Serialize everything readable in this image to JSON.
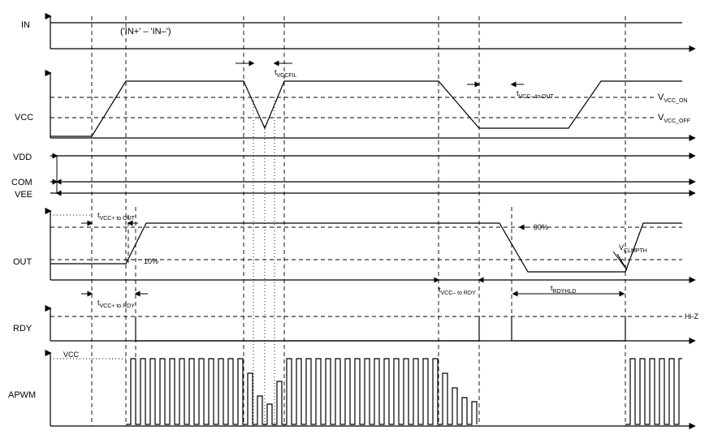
{
  "signal_labels": {
    "in": "IN",
    "vcc": "VCC",
    "vdd": "VDD",
    "com": "COM",
    "vee": "VEE",
    "out": "OUT",
    "rdy": "RDY",
    "vcc2": "VCC",
    "apwm": "APWM"
  },
  "annotations": {
    "in_formula": "('IN+' – 'IN–')",
    "t_vccfil": "t",
    "t_vccfil_sub": "VCCFIL",
    "t_vccm_out": "t",
    "t_vccm_out_sub": "VCC– to OUT",
    "v_vcc_on": "V",
    "v_vcc_on_sub": "VCC_ON",
    "v_vcc_off": "V",
    "v_vcc_off_sub": "VCC_OFF",
    "t_vccp_out": "t",
    "t_vccp_out_sub": "VCC+ to OUT",
    "pct90": "90%",
    "pct10": "10%",
    "v_clmpth": "V",
    "v_clmpth_sub": "CLMPTH",
    "t_vccp_rdy": "t",
    "t_vccp_rdy_sub": "VCC+ to RDY",
    "t_vccm_rdy": "t",
    "t_vccm_rdy_sub": "VCC– to RDY",
    "t_rdyhld": "t",
    "t_rdyhld_sub": "RDYHLD",
    "hiz": "Hi-Z"
  },
  "chart_data": {
    "type": "timing-diagram",
    "time_axis": "arbitrary",
    "signals": [
      {
        "name": "IN",
        "desc": "('IN+' – 'IN–') constant high"
      },
      {
        "name": "VCC",
        "events": [
          "ramp-up",
          "dip below Vvcc_off (filtered, width < tVCCFIL)",
          "recover",
          "drop below Vvcc_off (not filtered)",
          "hold low",
          "ramp-up"
        ],
        "thresholds": [
          "Vvcc_on",
          "Vvcc_off"
        ]
      },
      {
        "name": "VDD",
        "desc": "constant"
      },
      {
        "name": "COM",
        "desc": "constant"
      },
      {
        "name": "VEE",
        "desc": "constant"
      },
      {
        "name": "OUT",
        "events": [
          "low",
          "rise after tVCC+toOUT (10%→90%)",
          "high",
          "fall after second VCC drop",
          "low at Vclmpth",
          "rise after VCC recovery"
        ],
        "marks": [
          "10%",
          "90%",
          "Vclmpth"
        ]
      },
      {
        "name": "RDY",
        "events": [
          "Hi-Z",
          "driven high after tVCC+toRDY",
          "fall after tVCC-toRDY",
          "hold low for tRDYHLD",
          "Hi-Z"
        ]
      },
      {
        "name": "APWM",
        "desc": "PWM bursts while VCC valid, envelope follows VCC, idle otherwise",
        "envelope_label": "VCC"
      }
    ],
    "timing_params": [
      "tVCCFIL",
      "tVCC+ to OUT",
      "tVCC- to OUT",
      "tVCC+ to RDY",
      "tVCC- to RDY",
      "tRDYHLD"
    ]
  }
}
